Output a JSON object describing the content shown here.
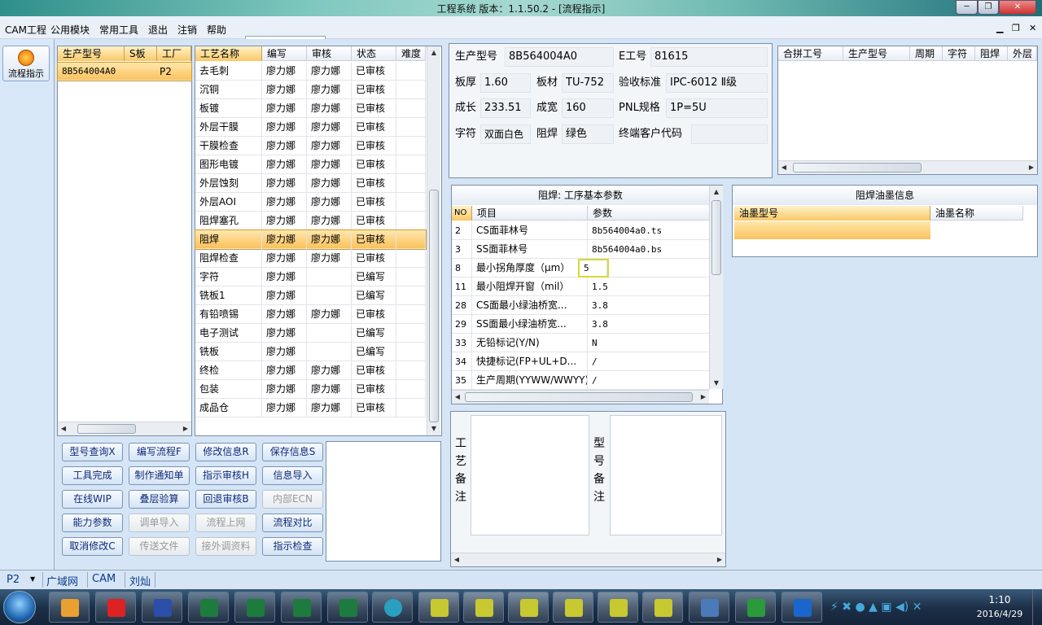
{
  "window": {
    "title": "工程系统   版本：1.1.50.2 - [流程指示]"
  },
  "menu": [
    "CAM工程",
    "公用模块",
    "常用工具",
    "退出",
    "注销",
    "帮助"
  ],
  "combo_value": "",
  "leftbar": {
    "flow_label": "流程指示"
  },
  "model_list": {
    "headers": [
      "生产型号",
      "S板",
      "工厂"
    ],
    "rows": [
      {
        "model": "8B564004A0",
        "s": "",
        "factory": "P2"
      }
    ]
  },
  "process_table": {
    "headers": [
      "工艺名称",
      "编写",
      "审核",
      "状态",
      "难度"
    ],
    "rows": [
      [
        "去毛刺",
        "廖力娜",
        "廖力娜",
        "已审核",
        ""
      ],
      [
        "沉铜",
        "廖力娜",
        "廖力娜",
        "已审核",
        ""
      ],
      [
        "板镀",
        "廖力娜",
        "廖力娜",
        "已审核",
        ""
      ],
      [
        "外层干膜",
        "廖力娜",
        "廖力娜",
        "已审核",
        ""
      ],
      [
        "干膜检查",
        "廖力娜",
        "廖力娜",
        "已审核",
        ""
      ],
      [
        "图形电镀",
        "廖力娜",
        "廖力娜",
        "已审核",
        ""
      ],
      [
        "外层蚀刻",
        "廖力娜",
        "廖力娜",
        "已审核",
        ""
      ],
      [
        "外层AOI",
        "廖力娜",
        "廖力娜",
        "已审核",
        ""
      ],
      [
        "阻焊塞孔",
        "廖力娜",
        "廖力娜",
        "已审核",
        ""
      ],
      [
        "阻焊",
        "廖力娜",
        "廖力娜",
        "已审核",
        ""
      ],
      [
        "阻焊检查",
        "廖力娜",
        "廖力娜",
        "已审核",
        ""
      ],
      [
        "字符",
        "廖力娜",
        "",
        "已编写",
        ""
      ],
      [
        "铣板1",
        "廖力娜",
        "",
        "已编写",
        ""
      ],
      [
        "有铅喷锡",
        "廖力娜",
        "廖力娜",
        "已审核",
        ""
      ],
      [
        "电子测试",
        "廖力娜",
        "",
        "已编写",
        ""
      ],
      [
        "铣板",
        "廖力娜",
        "",
        "已编写",
        ""
      ],
      [
        "终检",
        "廖力娜",
        "廖力娜",
        "已审核",
        ""
      ],
      [
        "包装",
        "廖力娜",
        "廖力娜",
        "已审核",
        ""
      ],
      [
        "成品仓",
        "廖力娜",
        "廖力娜",
        "已审核",
        ""
      ]
    ],
    "selected_index": 9
  },
  "buttons": [
    {
      "label": "型号查询X",
      "enabled": true
    },
    {
      "label": "编写流程F",
      "enabled": true
    },
    {
      "label": "修改信息R",
      "enabled": true
    },
    {
      "label": "保存信息S",
      "enabled": true
    },
    {
      "label": "工具完成",
      "enabled": true
    },
    {
      "label": "制作通知单",
      "enabled": true
    },
    {
      "label": "指示审核H",
      "enabled": true
    },
    {
      "label": "信息导入",
      "enabled": true
    },
    {
      "label": "在线WIP",
      "enabled": true
    },
    {
      "label": "叠层验算",
      "enabled": true
    },
    {
      "label": "回退审核B",
      "enabled": true
    },
    {
      "label": "内部ECN",
      "enabled": false
    },
    {
      "label": "能力参数",
      "enabled": true
    },
    {
      "label": "调单导入",
      "enabled": false
    },
    {
      "label": "流程上网",
      "enabled": false
    },
    {
      "label": "流程对比",
      "enabled": true
    },
    {
      "label": "取消修改C",
      "enabled": true
    },
    {
      "label": "传送文件",
      "enabled": false
    },
    {
      "label": "接外调资料",
      "enabled": false
    },
    {
      "label": "指示检查",
      "enabled": true
    }
  ],
  "info": {
    "model_label": "生产型号",
    "model": "8B564004A0",
    "eno_label": "E工号",
    "eno": "81615",
    "thick_label": "板厚",
    "thick": "1.60",
    "material_label": "板材",
    "material": "TU-752",
    "std_label": "验收标准",
    "std": "IPC-6012 Ⅱ级",
    "len_label": "成长",
    "len": "233.51",
    "width_label": "成宽",
    "width": "160",
    "pnl_label": "PNL规格",
    "pnl": "1P=5U",
    "char_label": "字符",
    "char": "双面白色",
    "mask_label": "阻焊",
    "mask": "绿色",
    "cust_label": "终端客户代码",
    "cust": ""
  },
  "merge_table": {
    "headers": [
      "合拼工号",
      "生产型号",
      "周期",
      "字符",
      "阻焊",
      "外层"
    ]
  },
  "params": {
    "title": "阻焊: 工序基本参数",
    "headers": [
      "NO",
      "项目",
      "参数"
    ],
    "rows": [
      [
        "2",
        "CS面菲林号",
        "8b564004a0.ts"
      ],
      [
        "3",
        "SS面菲林号",
        "8b564004a0.bs"
      ],
      [
        "8",
        "最小拐角厚度（μm）",
        "5"
      ],
      [
        "11",
        "最小阻焊开窗（mil）",
        "1.5"
      ],
      [
        "28",
        "CS面最小绿油桥宽...",
        "3.8"
      ],
      [
        "29",
        "SS面最小绿油桥宽...",
        "3.8"
      ],
      [
        "33",
        "无铅标记(Y/N)",
        "N"
      ],
      [
        "34",
        "快捷标记(FP+UL+D...",
        "/"
      ],
      [
        "35",
        "生产周期(YYWW/WWYY)",
        "/"
      ]
    ]
  },
  "ink": {
    "title": "阻焊油墨信息",
    "headers": [
      "油墨型号",
      "油墨名称"
    ]
  },
  "remarks": {
    "process": "工艺备注",
    "model": "型号备注"
  },
  "status": {
    "factory": "P2",
    "net": "广域网",
    "module": "CAM",
    "user": "刘灿"
  },
  "tray": {
    "time": "1:10",
    "date": "2016/4/29"
  }
}
